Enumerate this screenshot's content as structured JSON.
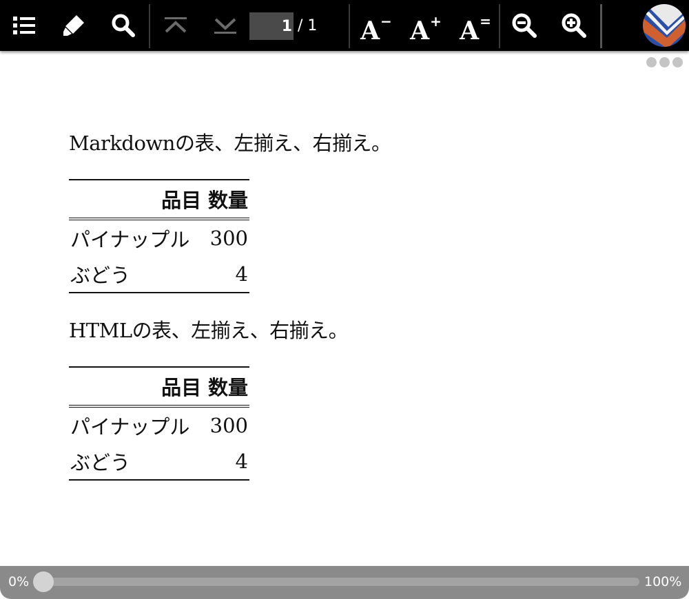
{
  "toolbar": {
    "icons": [
      "list-icon",
      "highlighter-icon",
      "search-icon",
      "page-first-icon",
      "page-last-icon",
      "font-decrease-icon",
      "font-increase-icon",
      "font-reset-icon",
      "zoom-out-icon",
      "zoom-in-icon"
    ],
    "page_current": "1",
    "page_total": "/ 1",
    "font_decrease_label": "A",
    "font_decrease_sup": "−",
    "font_increase_label": "A",
    "font_increase_sup": "+",
    "font_reset_label": "A",
    "font_reset_sup": "="
  },
  "document": {
    "sections": [
      {
        "caption": "Markdownの表、左揃え、右揃え。",
        "table": {
          "headers": [
            "品目",
            "数量"
          ],
          "rows": [
            [
              "パイナップル",
              "300"
            ],
            [
              "ぶどう",
              "4"
            ]
          ]
        }
      },
      {
        "caption": "HTMLの表、左揃え、右揃え。",
        "table": {
          "headers": [
            "品目",
            "数量"
          ],
          "rows": [
            [
              "パイナップル",
              "300"
            ],
            [
              "ぶどう",
              "4"
            ]
          ]
        }
      }
    ]
  },
  "progress": {
    "start_label": "0%",
    "end_label": "100%",
    "value_percent": 0
  },
  "colors": {
    "toolbar_bg": "#000000",
    "progress_bg": "#8a8a8a",
    "logo_blue": "#2a4fa8",
    "logo_orange": "#d0602f"
  }
}
